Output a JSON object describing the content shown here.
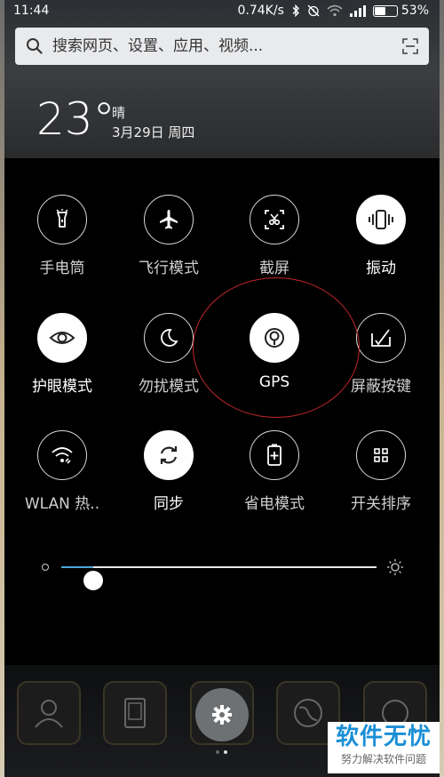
{
  "status_bar": {
    "time": "11:44",
    "speed": "0.74K/s",
    "battery": "53%",
    "battery_level": 0.53
  },
  "search": {
    "placeholder": "搜索网页、设置、应用、视频..."
  },
  "weather": {
    "temperature": "23°",
    "condition": "晴",
    "date": "3月29日 周四"
  },
  "toggles": [
    {
      "label": "手电筒",
      "icon": "flashlight-icon",
      "on": false
    },
    {
      "label": "飞行模式",
      "icon": "airplane-icon",
      "on": false
    },
    {
      "label": "截屏",
      "icon": "screenshot-icon",
      "on": false
    },
    {
      "label": "振动",
      "icon": "vibrate-icon",
      "on": true
    },
    {
      "label": "护眼模式",
      "icon": "eye-icon",
      "on": true
    },
    {
      "label": "勿扰模式",
      "icon": "moon-icon",
      "on": false
    },
    {
      "label": "GPS",
      "icon": "gps-icon",
      "on": true
    },
    {
      "label": "屏蔽按键",
      "icon": "block-keys-icon",
      "on": false
    },
    {
      "label": "WLAN 热..",
      "icon": "hotspot-icon",
      "on": false
    },
    {
      "label": "同步",
      "icon": "sync-icon",
      "on": true
    },
    {
      "label": "省电模式",
      "icon": "battery-saver-icon",
      "on": false
    },
    {
      "label": "开关排序",
      "icon": "grid-icon",
      "on": false
    }
  ],
  "brightness": {
    "level": 0.1
  },
  "watermark": {
    "title": "软件无忧",
    "subtitle": "努力解决软件问题"
  },
  "colors": {
    "accent": "#4aa6d9",
    "highlight": "#c0262a",
    "watermark": "#1a8fd6"
  }
}
